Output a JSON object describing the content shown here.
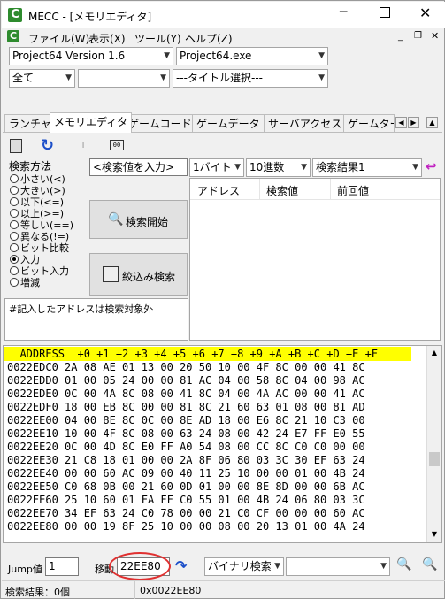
{
  "window": {
    "title": "MECC - [メモリエディタ]"
  },
  "menu": [
    "ファイル(W)",
    "表示(X)",
    "ツール(Y)",
    "ヘルプ(Z)"
  ],
  "selectors": {
    "project": "Project64 Version 1.6",
    "exe": "Project64.exe",
    "all": "全て",
    "blank": "",
    "title_select": "---タイトル選択---"
  },
  "tabs": [
    "ランチャ",
    "メモリエディタ",
    "ゲームコード",
    "ゲームデータ",
    "サーバアクセス",
    "ゲームター"
  ],
  "search": {
    "method_label": "検索方法",
    "methods": [
      "小さい(<)",
      "大きい(>)",
      "以下(<=)",
      "以上(>=)",
      "等しい(==)",
      "異なる(!=)",
      "ビット比較",
      "入力",
      "ビット入力",
      "増減"
    ],
    "selected": "入力",
    "value_placeholder": "<検索値を入力>",
    "size": "1バイト",
    "radix": "10進数",
    "results_select": "検索結果1",
    "start_button": "検索開始",
    "refine_button": "絞込み検索",
    "note": "#記入したアドレスは検索対象外",
    "result_cols": [
      "アドレス",
      "検索値",
      "前回値"
    ]
  },
  "hex": {
    "header": "  ADDRESS  +0 +1 +2 +3 +4 +5 +6 +7 +8 +9 +A +B +C +D +E +F",
    "rows": [
      "0022EDC0 2A 08 AE 01 13 00 20 50 10 00 4F 8C 00 00 41 8C",
      "0022EDD0 01 00 05 24 00 00 81 AC 04 00 58 8C 04 00 98 AC",
      "0022EDE0 0C 00 4A 8C 08 00 41 8C 04 00 4A AC 00 00 41 AC",
      "0022EDF0 18 00 EB 8C 00 00 81 8C 21 60 63 01 08 00 81 AD",
      "0022EE00 04 00 8E 8C 0C 00 8E AD 18 00 E6 8C 21 10 C3 00",
      "0022EE10 10 00 4F 8C 08 00 63 24 08 00 42 24 E7 FF E0 55",
      "0022EE20 0C 00 4D 8C E0 FF A0 54 08 00 CC 8C C0 C0 00 00",
      "0022EE30 21 C8 18 01 00 00 2A 8F 06 80 03 3C 30 EF 63 24",
      "0022EE40 00 00 60 AC 09 00 40 11 25 10 00 00 01 00 4B 24",
      "0022EE50 C0 68 0B 00 21 60 0D 01 00 00 8E 8D 00 00 6B AC",
      "0022EE60 25 10 60 01 FA FF C0 55 01 00 4B 24 06 80 03 3C",
      "0022EE70 34 EF 63 24 C0 78 00 00 21 C0 CF 00 00 00 60 AC",
      "0022EE80 00 00 19 8F 25 10 00 00 08 00 20 13 01 00 4A 24"
    ]
  },
  "bottom": {
    "jump_label": "Jump値",
    "jump_value": "1",
    "move_label": "移動",
    "address": "22EE80",
    "search_mode": "バイナリ検索",
    "search_field": ""
  },
  "status": {
    "results": "検索結果：0個",
    "address": "0x0022EE80"
  },
  "colors": {
    "hex_header_bg": "#ffff00",
    "hex_addr": "#000000",
    "highlight_circle": "#e03030"
  }
}
